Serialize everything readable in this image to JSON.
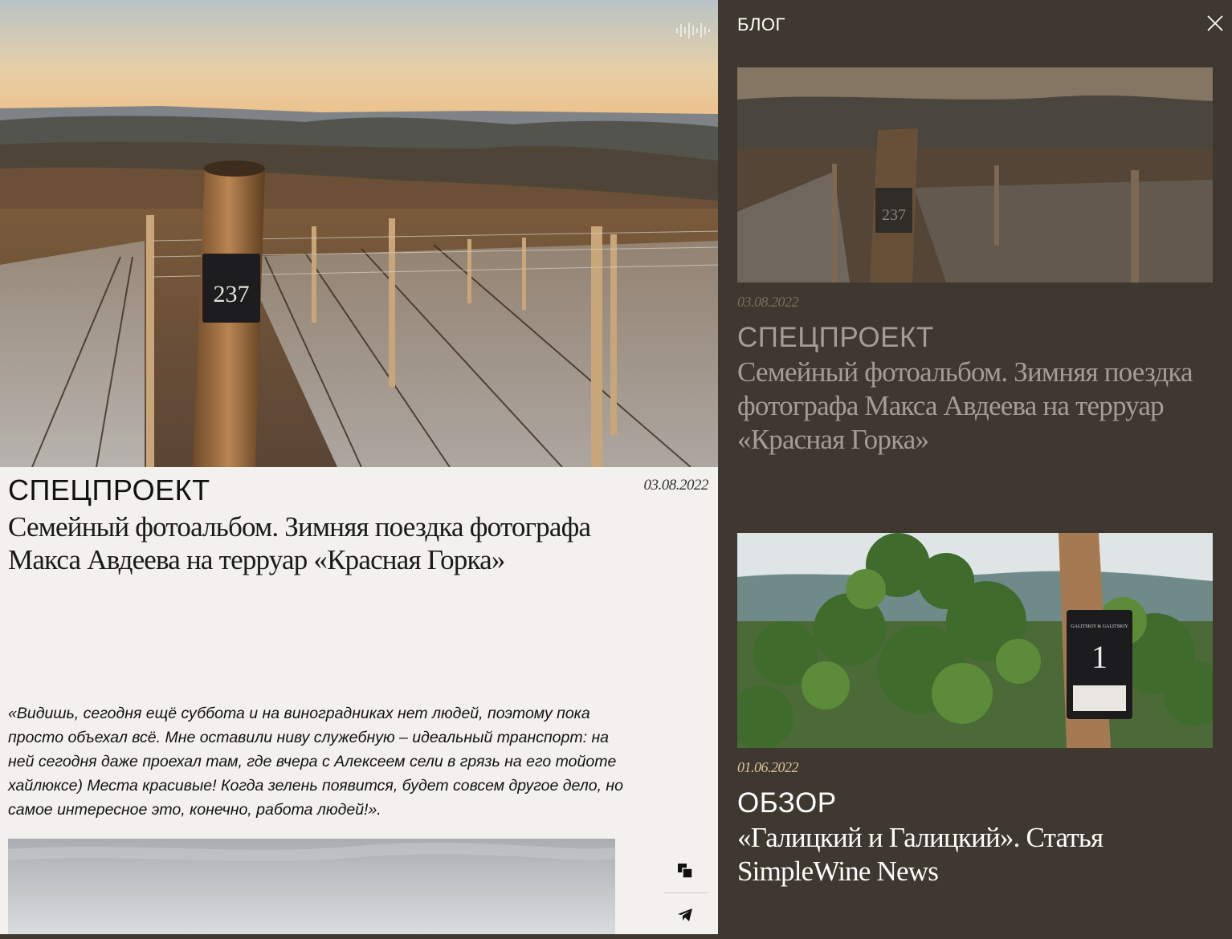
{
  "article": {
    "category": "СПЕЦПРОЕКТ",
    "date": "03.08.2022",
    "title": "Семейный фотоальбом. Зимняя поездка фотографа Макса Авдеева на терруар «Красная Горка»",
    "quote": "«Видишь, сегодня ещё суббота и на виноградниках нет людей, поэтому пока просто объехал всё. Мне оставили ниву служебную – идеальный транспорт: на ней сегодня даже проехал там, где вчера с Алексеем сели в грязь на его тойоте хайлюксе) Места красивые! Когда зелень появится, будет совсем другое дело, но самое интересное это, конечно, работа людей!».",
    "post_number": "237"
  },
  "blog": {
    "title": "БЛОГ",
    "posts": [
      {
        "date": "03.08.2022",
        "category": "СПЕЦПРОЕКТ",
        "title": "Семейный фотоальбом. Зимняя поездка фотографа Макса Авдеева на терруар «Красная Горка»",
        "post_number": "237"
      },
      {
        "date": "01.06.2022",
        "category": "ОБЗОР",
        "title": "«Галицкий и Галицкий». Статья SimpleWine News",
        "post_number": "1",
        "brand_text": "GALITSKIY & GALITSKIY"
      }
    ]
  },
  "icons": {
    "sound": "sound-wave-icon",
    "close": "close-icon",
    "copy": "copy-link-icon",
    "telegram": "telegram-icon"
  },
  "colors": {
    "panel_bg": "#3f3830",
    "article_bg": "#f2f1ee",
    "date_accent": "#d8c59a"
  }
}
